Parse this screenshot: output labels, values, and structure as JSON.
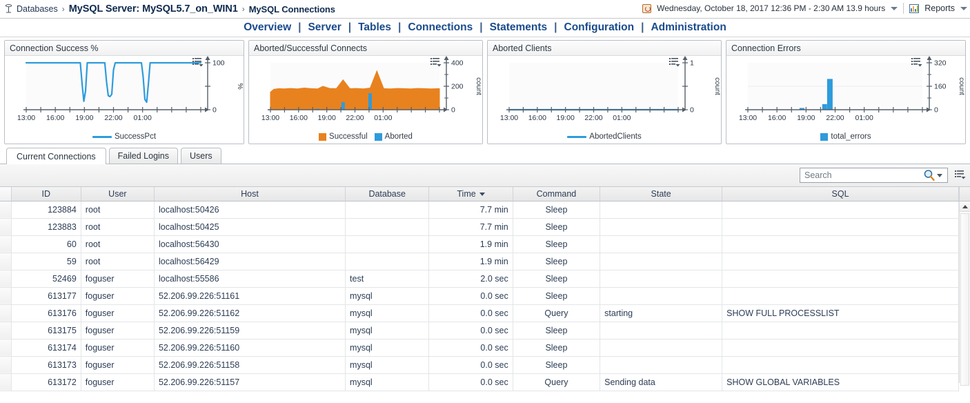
{
  "breadcrumb": {
    "icon": "database-tree-icon",
    "root": "Databases",
    "sep": "›",
    "server": "MySQL Server: MySQL5.7_on_WIN1",
    "page": "MySQL Connections"
  },
  "topright": {
    "clock_icon": "history-clock-icon",
    "date_range": "Wednesday, October 18, 2017 12:36 PM - 2:30 AM 13.9 hours",
    "reports_icon": "reports-chart-icon",
    "reports_label": "Reports"
  },
  "nav": {
    "items": [
      "Overview",
      "Server",
      "Tables",
      "Connections",
      "Statements",
      "Configuration",
      "Administration"
    ],
    "separator": "|",
    "active": "Connections"
  },
  "colors": {
    "accent_blue": "#2e9bdc",
    "orange": "#e8821e",
    "nav_link": "#1a4b8c",
    "grid_text": "#2c3d55"
  },
  "chart_data": [
    {
      "type": "line",
      "title": "Connection Success %",
      "xlabel": "",
      "ylabel": "%",
      "ylim": [
        0,
        100
      ],
      "yticks": [
        "0",
        "100"
      ],
      "xticks": [
        "13:00",
        "16:00",
        "19:00",
        "22:00",
        "01:00"
      ],
      "grid": false,
      "legend_position": "bottom",
      "series": [
        {
          "name": "SuccessPct",
          "color": "#2e9bdc",
          "x": [
            0,
            4,
            8,
            12,
            16,
            20,
            24,
            28,
            30,
            31,
            32,
            33,
            34,
            35,
            36,
            38,
            42,
            44,
            45,
            46,
            47,
            48,
            49,
            50,
            51,
            52,
            56,
            60,
            64,
            66,
            67,
            68,
            69,
            70,
            71,
            72,
            76,
            80,
            84,
            88,
            92,
            96,
            100
          ],
          "values": [
            100,
            100,
            100,
            100,
            100,
            100,
            100,
            100,
            100,
            100,
            55,
            18,
            40,
            100,
            100,
            100,
            100,
            100,
            100,
            60,
            30,
            28,
            33,
            85,
            100,
            100,
            100,
            100,
            100,
            100,
            70,
            22,
            16,
            55,
            100,
            100,
            100,
            100,
            100,
            100,
            100,
            100,
            100
          ]
        }
      ]
    },
    {
      "type": "area",
      "title": "Aborted/Successful Connects",
      "xlabel": "",
      "ylabel": "count",
      "ylim": [
        0,
        400
      ],
      "yticks": [
        "0",
        "200",
        "400"
      ],
      "xticks": [
        "13:00",
        "16:00",
        "19:00",
        "22:00",
        "01:00"
      ],
      "grid": false,
      "legend_position": "bottom",
      "series": [
        {
          "name": "Successful",
          "color": "#e8821e",
          "x": [
            0,
            2,
            5,
            8,
            12,
            16,
            20,
            24,
            28,
            31,
            35,
            39,
            43,
            47,
            51,
            55,
            59,
            63,
            67,
            71,
            75,
            79,
            83,
            87,
            91,
            95,
            100
          ],
          "values": [
            150,
            175,
            180,
            178,
            182,
            178,
            185,
            180,
            178,
            200,
            182,
            180,
            255,
            180,
            182,
            178,
            185,
            330,
            180,
            178,
            182,
            180,
            178,
            182,
            180,
            178,
            180
          ]
        },
        {
          "name": "Aborted",
          "color": "#2e9bdc",
          "x": [
            28,
            43,
            59
          ],
          "values": [
            8,
            65,
            140
          ]
        }
      ]
    },
    {
      "type": "line",
      "title": "Aborted Clients",
      "xlabel": "",
      "ylabel": "count",
      "ylim": [
        0,
        1
      ],
      "yticks": [
        "0",
        "1"
      ],
      "xticks": [
        "13:00",
        "16:00",
        "19:00",
        "22:00",
        "01:00"
      ],
      "grid": false,
      "legend_position": "bottom",
      "series": [
        {
          "name": "AbortedClients",
          "color": "#2e9bdc",
          "x": [
            0,
            25,
            50,
            75,
            100
          ],
          "values": [
            0,
            0,
            0,
            0,
            0
          ]
        }
      ]
    },
    {
      "type": "bar",
      "title": "Connection Errors",
      "xlabel": "",
      "ylabel": "count",
      "ylim": [
        0,
        320
      ],
      "yticks": [
        "0",
        "160",
        "320"
      ],
      "xticks": [
        "13:00",
        "16:00",
        "19:00",
        "22:00",
        "01:00"
      ],
      "grid": true,
      "legend_position": "bottom",
      "series": [
        {
          "name": "total_errors",
          "color": "#2e9bdc",
          "x": [
            31,
            44,
            47
          ],
          "values": [
            12,
            38,
            210
          ]
        }
      ]
    }
  ],
  "tabs": [
    {
      "label": "Current Connections",
      "active": true
    },
    {
      "label": "Failed Logins",
      "active": false
    },
    {
      "label": "Users",
      "active": false
    }
  ],
  "toolbar": {
    "search_placeholder": "Search",
    "search_value": "",
    "search_icon": "magnifier-icon",
    "grid_menu_icon": "grid-options-icon"
  },
  "table": {
    "columns": [
      "ID",
      "User",
      "Host",
      "Database",
      "Time",
      "Command",
      "State",
      "SQL"
    ],
    "sort_column": "Time",
    "sort_direction": "desc",
    "rows": [
      {
        "id": "123884",
        "user": "root",
        "host": "localhost:50426",
        "database": "",
        "time": "7.7 min",
        "command": "Sleep",
        "state": "",
        "sql": ""
      },
      {
        "id": "123883",
        "user": "root",
        "host": "localhost:50425",
        "database": "",
        "time": "7.7 min",
        "command": "Sleep",
        "state": "",
        "sql": ""
      },
      {
        "id": "60",
        "user": "root",
        "host": "localhost:56430",
        "database": "",
        "time": "1.9 min",
        "command": "Sleep",
        "state": "",
        "sql": ""
      },
      {
        "id": "59",
        "user": "root",
        "host": "localhost:56429",
        "database": "",
        "time": "1.9 min",
        "command": "Sleep",
        "state": "",
        "sql": ""
      },
      {
        "id": "52469",
        "user": "foguser",
        "host": "localhost:55586",
        "database": "test",
        "time": "2.0 sec",
        "command": "Sleep",
        "state": "",
        "sql": ""
      },
      {
        "id": "613177",
        "user": "foguser",
        "host": "52.206.99.226:51161",
        "database": "mysql",
        "time": "0.0 sec",
        "command": "Sleep",
        "state": "",
        "sql": ""
      },
      {
        "id": "613176",
        "user": "foguser",
        "host": "52.206.99.226:51162",
        "database": "mysql",
        "time": "0.0 sec",
        "command": "Query",
        "state": "starting",
        "sql": "SHOW FULL PROCESSLIST"
      },
      {
        "id": "613175",
        "user": "foguser",
        "host": "52.206.99.226:51159",
        "database": "mysql",
        "time": "0.0 sec",
        "command": "Sleep",
        "state": "",
        "sql": ""
      },
      {
        "id": "613174",
        "user": "foguser",
        "host": "52.206.99.226:51160",
        "database": "mysql",
        "time": "0.0 sec",
        "command": "Sleep",
        "state": "",
        "sql": ""
      },
      {
        "id": "613173",
        "user": "foguser",
        "host": "52.206.99.226:51158",
        "database": "mysql",
        "time": "0.0 sec",
        "command": "Sleep",
        "state": "",
        "sql": ""
      },
      {
        "id": "613172",
        "user": "foguser",
        "host": "52.206.99.226:51157",
        "database": "mysql",
        "time": "0.0 sec",
        "command": "Query",
        "state": "Sending data",
        "sql": "SHOW GLOBAL VARIABLES"
      }
    ]
  }
}
